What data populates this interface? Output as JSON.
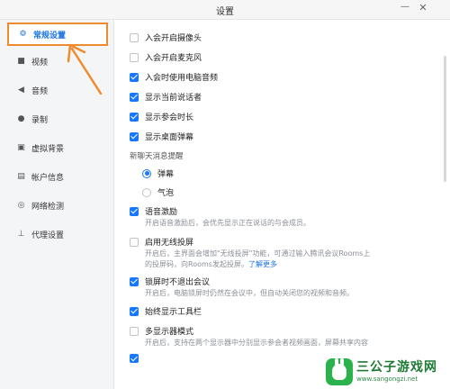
{
  "window": {
    "title": "设置",
    "minimize_glyph": "—",
    "close_glyph": "✕"
  },
  "sidebar": {
    "items": [
      {
        "label": "常规设置",
        "icon": "gear-icon",
        "glyph": "⚙"
      },
      {
        "label": "视频",
        "icon": "video-camera-icon",
        "glyph": "■"
      },
      {
        "label": "音频",
        "icon": "speaker-icon",
        "glyph": "◀"
      },
      {
        "label": "录制",
        "icon": "record-icon",
        "glyph": "●"
      },
      {
        "label": "虚拟背景",
        "icon": "person-frame-icon",
        "glyph": "▣"
      },
      {
        "label": "帐户信息",
        "icon": "account-card-icon",
        "glyph": "▤"
      },
      {
        "label": "网络检测",
        "icon": "globe-icon",
        "glyph": "◎"
      },
      {
        "label": "代理设置",
        "icon": "network-tree-icon",
        "glyph": "⊥"
      }
    ],
    "active_index": 0,
    "highlight_color": "#f08a2e"
  },
  "settings": {
    "camera_on_join": {
      "label": "入会开启摄像头",
      "checked": false
    },
    "mic_on_join": {
      "label": "入会开启麦克风",
      "checked": false
    },
    "computer_audio_on_join": {
      "label": "入会时使用电脑音频",
      "checked": true
    },
    "show_speaker": {
      "label": "显示当前说话者",
      "checked": true
    },
    "show_duration": {
      "label": "显示参会时长",
      "checked": true
    },
    "show_desktop_danmaku": {
      "label": "显示桌面弹幕",
      "checked": true
    },
    "chat_notify": {
      "label": "新聊天消息提醒",
      "options": [
        {
          "label": "弹幕",
          "selected": true
        },
        {
          "label": "气泡",
          "selected": false
        }
      ]
    },
    "voice_motivation": {
      "label": "语音激励",
      "checked": true,
      "desc": "开启语音激励后，会优先显示正在说话的与会成员。"
    },
    "wireless_cast": {
      "label": "启用无线投屏",
      "checked": false,
      "desc_line1": "开启后，主界面会增加\"无线投屏\"功能，可通过输入腾讯会议Rooms上",
      "desc_line2": "的投屏码，向Rooms发起投屏。",
      "link": "了解更多"
    },
    "no_exit_on_lock": {
      "label": "锁屏时不退出会议",
      "checked": true,
      "desc": "开启后，电脑锁屏时仍然在会议中，但自动关闭您的视频和音频。"
    },
    "always_show_toolbar": {
      "label": "始终显示工具栏",
      "checked": true
    },
    "multi_display": {
      "label": "多显示器模式",
      "checked": false,
      "desc": "开启后，支持在两个显示器中分别显示参会者视频画面，屏幕共享内容"
    },
    "partial_row": {
      "checked": true
    }
  },
  "colors": {
    "accent": "#1677ff",
    "arrow": "#f08a2e"
  },
  "watermark": {
    "name": "三公子游戏网",
    "url": "www.sangongzi.net"
  }
}
